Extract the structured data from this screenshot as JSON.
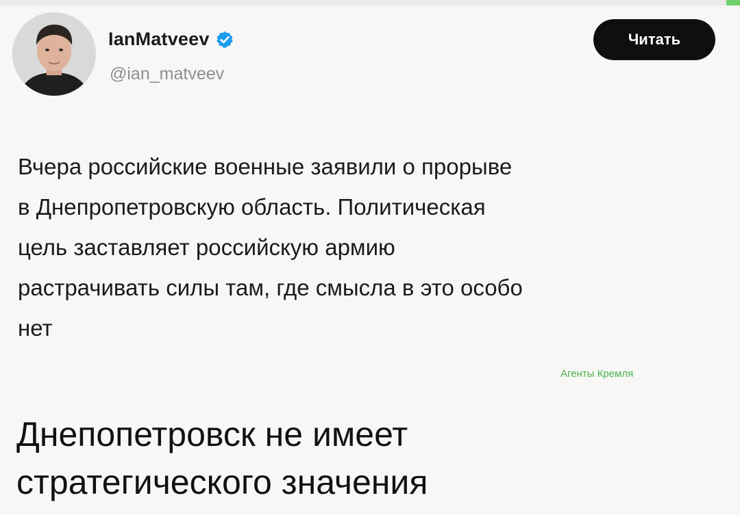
{
  "post": {
    "author": {
      "display_name": "IanMatveev",
      "handle": "@ian_matveev",
      "verified": true
    },
    "follow_button_label": "Читать",
    "text": "Вчера российские военные заявили о прорыве\nв Днепропетровскую область. Политическая\nцель заставляет российскую армию\nрастрачивать силы там, где смысла в это особо\nнет"
  },
  "watermark": "Агенты Кремля",
  "caption": "Днепопетровск не имеет\nстратегического значения",
  "colors": {
    "verified": "#1d9bf0",
    "follow_button_bg": "#0f0f0f",
    "watermark": "#49b34a",
    "accent_green": "#6fd16a"
  },
  "icons": {
    "verified": "verified-badge-icon",
    "avatar": "user-avatar"
  }
}
